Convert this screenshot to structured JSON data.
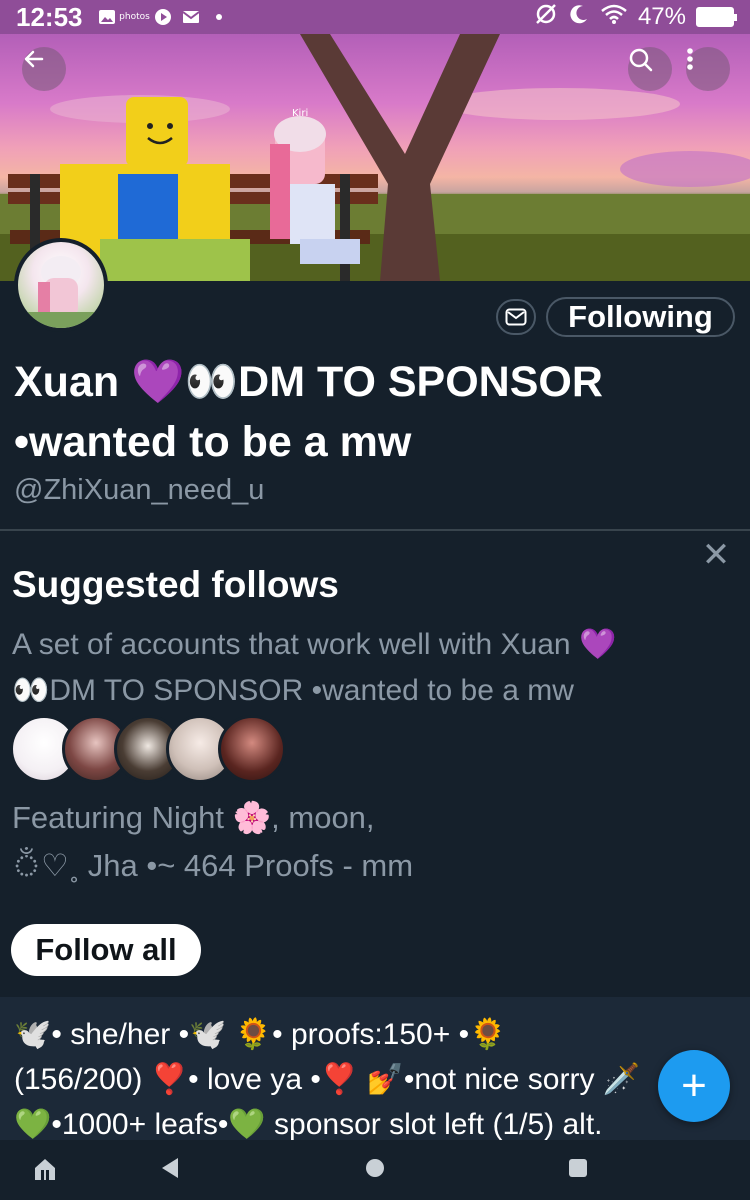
{
  "status_bar": {
    "time": "12:53",
    "photos_label": "photos",
    "battery": "47%"
  },
  "profile": {
    "name_line1": "Xuan 💜👀DM TO SPONSOR",
    "name_line2": "•wanted to be a mw",
    "handle": "@ZhiXuan_need_u",
    "following_label": "Following",
    "banner_sign": "Kiri"
  },
  "suggested": {
    "title": "Suggested follows",
    "desc_line1": "A set of accounts that work well with Xuan 💜",
    "desc_line2": "👀DM TO SPONSOR •wanted to be a mw",
    "featuring_line1": "Featuring Night 🌸, moon,",
    "featuring_line2": "ঁ♡˳ Jha •~ 464 Proofs - mm",
    "follow_all_label": "Follow all"
  },
  "bio": {
    "line1": "🕊️• she/her •🕊️ 🌻• proofs:150+ •🌻",
    "line2": "(156/200) ❣️• love ya •❣️ 💅•not nice sorry 🗡️",
    "line3": "💚•1000+ leafs•💚 sponsor slot left (1/5)  alt."
  },
  "fab": {
    "label": "+"
  },
  "colors": {
    "background": "#15202b",
    "status_bar": "#8f4d98",
    "secondary_text": "#8b98a5",
    "accent": "#1d9bf0"
  },
  "icons": [
    "back-arrow-icon",
    "search-icon",
    "more-vertical-icon",
    "mail-icon",
    "close-icon",
    "compose-plus-icon",
    "home-icon",
    "nav-back-icon",
    "nav-home-circle-icon",
    "nav-recents-icon"
  ]
}
